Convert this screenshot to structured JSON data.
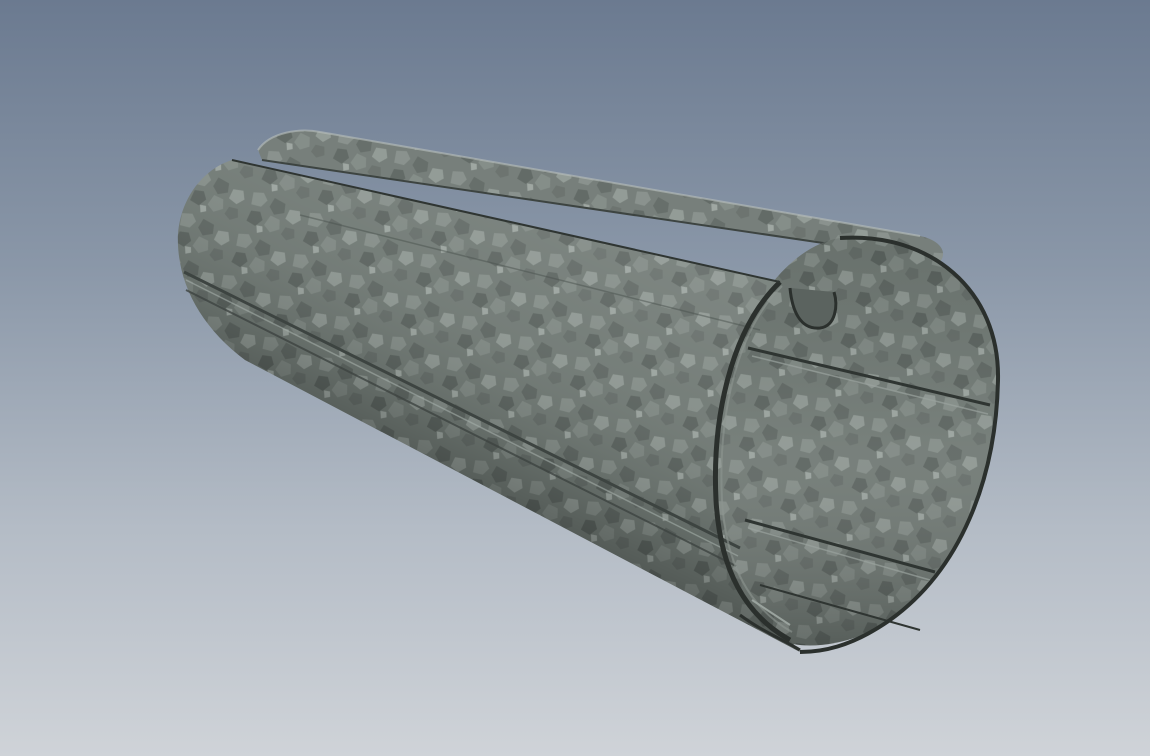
{
  "scene": {
    "subject": "galvanized-tube-icon",
    "background_top_color": "#6b7a90",
    "background_bottom_color": "#cfd3d8",
    "metal_base_color": "#6f7873",
    "metal_highlight_color": "#a9b0ac",
    "metal_shadow_color": "#3c4340"
  }
}
